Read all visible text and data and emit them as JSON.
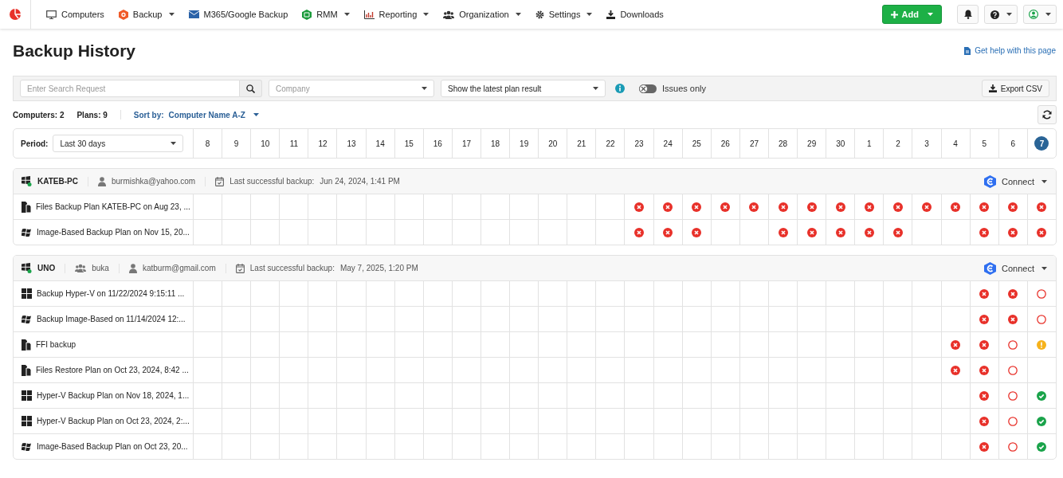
{
  "nav": {
    "items": [
      {
        "label": "Computers",
        "dropdown": false
      },
      {
        "label": "Backup",
        "dropdown": true
      },
      {
        "label": "M365/Google Backup",
        "dropdown": false
      },
      {
        "label": "RMM",
        "dropdown": true
      },
      {
        "label": "Reporting",
        "dropdown": true
      },
      {
        "label": "Organization",
        "dropdown": true
      },
      {
        "label": "Settings",
        "dropdown": true
      },
      {
        "label": "Downloads",
        "dropdown": false
      }
    ],
    "add_button": "Add"
  },
  "page": {
    "title": "Backup History",
    "help_link": "Get help with this page"
  },
  "filters": {
    "search": {
      "placeholder": "Enter Search Request"
    },
    "company": {
      "placeholder": "Company"
    },
    "result_mode": "Show the latest plan result",
    "issues_only": {
      "label": "Issues only",
      "on": false
    },
    "export": "Export CSV"
  },
  "summary": {
    "computers_label": "Computers:",
    "computers": "2",
    "plans_label": "Plans:",
    "plans": "9",
    "sort_label": "Sort by:",
    "sort_value": "Computer Name A-Z"
  },
  "period": {
    "label": "Period:",
    "value": "Last 30 days"
  },
  "days": [
    {
      "label": "8",
      "selected": false
    },
    {
      "label": "9",
      "selected": false
    },
    {
      "label": "10",
      "selected": false
    },
    {
      "label": "11",
      "selected": false
    },
    {
      "label": "12",
      "selected": false
    },
    {
      "label": "13",
      "selected": false
    },
    {
      "label": "14",
      "selected": false
    },
    {
      "label": "15",
      "selected": false
    },
    {
      "label": "16",
      "selected": false
    },
    {
      "label": "17",
      "selected": false
    },
    {
      "label": "18",
      "selected": false
    },
    {
      "label": "19",
      "selected": false
    },
    {
      "label": "20",
      "selected": false
    },
    {
      "label": "21",
      "selected": false
    },
    {
      "label": "22",
      "selected": false
    },
    {
      "label": "23",
      "selected": false
    },
    {
      "label": "24",
      "selected": false
    },
    {
      "label": "25",
      "selected": false
    },
    {
      "label": "26",
      "selected": false
    },
    {
      "label": "27",
      "selected": false
    },
    {
      "label": "28",
      "selected": false
    },
    {
      "label": "29",
      "selected": false
    },
    {
      "label": "30",
      "selected": false
    },
    {
      "label": "1",
      "selected": false
    },
    {
      "label": "2",
      "selected": false
    },
    {
      "label": "3",
      "selected": false
    },
    {
      "label": "4",
      "selected": false
    },
    {
      "label": "5",
      "selected": false
    },
    {
      "label": "6",
      "selected": false
    },
    {
      "label": "7",
      "selected": true
    }
  ],
  "groups": [
    {
      "computer": "KATEB-PC",
      "online": true,
      "email": "burmishka@yahoo.com",
      "last_backup_label": "Last successful backup:",
      "last_backup": "Jun 24, 2024, 1:41 PM",
      "connect": "Connect",
      "plans": [
        {
          "kind": "files",
          "name": "Files Backup Plan KATEB-PC on Aug 23, ...",
          "cells": [
            {
              "kind": "empty"
            },
            {
              "kind": "empty"
            },
            {
              "kind": "empty"
            },
            {
              "kind": "empty"
            },
            {
              "kind": "empty"
            },
            {
              "kind": "empty"
            },
            {
              "kind": "empty"
            },
            {
              "kind": "empty"
            },
            {
              "kind": "empty"
            },
            {
              "kind": "empty"
            },
            {
              "kind": "empty"
            },
            {
              "kind": "empty"
            },
            {
              "kind": "empty"
            },
            {
              "kind": "empty"
            },
            {
              "kind": "empty"
            },
            {
              "kind": "failed"
            },
            {
              "kind": "failed"
            },
            {
              "kind": "failed"
            },
            {
              "kind": "failed"
            },
            {
              "kind": "failed"
            },
            {
              "kind": "failed"
            },
            {
              "kind": "failed"
            },
            {
              "kind": "failed"
            },
            {
              "kind": "failed"
            },
            {
              "kind": "failed"
            },
            {
              "kind": "failed"
            },
            {
              "kind": "failed"
            },
            {
              "kind": "failed"
            },
            {
              "kind": "failed"
            },
            {
              "kind": "failed"
            }
          ]
        },
        {
          "kind": "image",
          "name": "Image-Based Backup Plan on Nov 15, 20...",
          "cells": [
            {
              "kind": "empty"
            },
            {
              "kind": "empty"
            },
            {
              "kind": "empty"
            },
            {
              "kind": "empty"
            },
            {
              "kind": "empty"
            },
            {
              "kind": "empty"
            },
            {
              "kind": "empty"
            },
            {
              "kind": "empty"
            },
            {
              "kind": "empty"
            },
            {
              "kind": "empty"
            },
            {
              "kind": "empty"
            },
            {
              "kind": "empty"
            },
            {
              "kind": "empty"
            },
            {
              "kind": "empty"
            },
            {
              "kind": "empty"
            },
            {
              "kind": "failed"
            },
            {
              "kind": "failed"
            },
            {
              "kind": "failed"
            },
            {
              "kind": "empty"
            },
            {
              "kind": "empty"
            },
            {
              "kind": "failed"
            },
            {
              "kind": "failed"
            },
            {
              "kind": "failed"
            },
            {
              "kind": "failed"
            },
            {
              "kind": "failed"
            },
            {
              "kind": "empty"
            },
            {
              "kind": "empty"
            },
            {
              "kind": "failed"
            },
            {
              "kind": "failed"
            },
            {
              "kind": "failed"
            }
          ]
        }
      ]
    },
    {
      "computer": "UNO",
      "online": true,
      "company": "buka",
      "email": "katburm@gmail.com",
      "last_backup_label": "Last successful backup:",
      "last_backup": "May 7, 2025, 1:20 PM",
      "connect": "Connect",
      "plans": [
        {
          "kind": "hyperv",
          "name": "Backup Hyper-V on 11/22/2024 9:15:11 ...",
          "cells": [
            {
              "kind": "empty"
            },
            {
              "kind": "empty"
            },
            {
              "kind": "empty"
            },
            {
              "kind": "empty"
            },
            {
              "kind": "empty"
            },
            {
              "kind": "empty"
            },
            {
              "kind": "empty"
            },
            {
              "kind": "empty"
            },
            {
              "kind": "empty"
            },
            {
              "kind": "empty"
            },
            {
              "kind": "empty"
            },
            {
              "kind": "empty"
            },
            {
              "kind": "empty"
            },
            {
              "kind": "empty"
            },
            {
              "kind": "empty"
            },
            {
              "kind": "empty"
            },
            {
              "kind": "empty"
            },
            {
              "kind": "empty"
            },
            {
              "kind": "empty"
            },
            {
              "kind": "empty"
            },
            {
              "kind": "empty"
            },
            {
              "kind": "empty"
            },
            {
              "kind": "empty"
            },
            {
              "kind": "empty"
            },
            {
              "kind": "empty"
            },
            {
              "kind": "empty"
            },
            {
              "kind": "empty"
            },
            {
              "kind": "failed"
            },
            {
              "kind": "failed"
            },
            {
              "kind": "missed"
            }
          ]
        },
        {
          "kind": "image",
          "name": "Backup Image-Based on 11/14/2024 12:...",
          "cells": [
            {
              "kind": "empty"
            },
            {
              "kind": "empty"
            },
            {
              "kind": "empty"
            },
            {
              "kind": "empty"
            },
            {
              "kind": "empty"
            },
            {
              "kind": "empty"
            },
            {
              "kind": "empty"
            },
            {
              "kind": "empty"
            },
            {
              "kind": "empty"
            },
            {
              "kind": "empty"
            },
            {
              "kind": "empty"
            },
            {
              "kind": "empty"
            },
            {
              "kind": "empty"
            },
            {
              "kind": "empty"
            },
            {
              "kind": "empty"
            },
            {
              "kind": "empty"
            },
            {
              "kind": "empty"
            },
            {
              "kind": "empty"
            },
            {
              "kind": "empty"
            },
            {
              "kind": "empty"
            },
            {
              "kind": "empty"
            },
            {
              "kind": "empty"
            },
            {
              "kind": "empty"
            },
            {
              "kind": "empty"
            },
            {
              "kind": "empty"
            },
            {
              "kind": "empty"
            },
            {
              "kind": "empty"
            },
            {
              "kind": "failed"
            },
            {
              "kind": "failed"
            },
            {
              "kind": "missed"
            }
          ]
        },
        {
          "kind": "files",
          "name": "FFI backup",
          "cells": [
            {
              "kind": "empty"
            },
            {
              "kind": "empty"
            },
            {
              "kind": "empty"
            },
            {
              "kind": "empty"
            },
            {
              "kind": "empty"
            },
            {
              "kind": "empty"
            },
            {
              "kind": "empty"
            },
            {
              "kind": "empty"
            },
            {
              "kind": "empty"
            },
            {
              "kind": "empty"
            },
            {
              "kind": "empty"
            },
            {
              "kind": "empty"
            },
            {
              "kind": "empty"
            },
            {
              "kind": "empty"
            },
            {
              "kind": "empty"
            },
            {
              "kind": "empty"
            },
            {
              "kind": "empty"
            },
            {
              "kind": "empty"
            },
            {
              "kind": "empty"
            },
            {
              "kind": "empty"
            },
            {
              "kind": "empty"
            },
            {
              "kind": "empty"
            },
            {
              "kind": "empty"
            },
            {
              "kind": "empty"
            },
            {
              "kind": "empty"
            },
            {
              "kind": "empty"
            },
            {
              "kind": "failed"
            },
            {
              "kind": "failed"
            },
            {
              "kind": "missed"
            },
            {
              "kind": "warning"
            }
          ]
        },
        {
          "kind": "files",
          "name": "Files Restore Plan on Oct 23, 2024, 8:42 ...",
          "cells": [
            {
              "kind": "empty"
            },
            {
              "kind": "empty"
            },
            {
              "kind": "empty"
            },
            {
              "kind": "empty"
            },
            {
              "kind": "empty"
            },
            {
              "kind": "empty"
            },
            {
              "kind": "empty"
            },
            {
              "kind": "empty"
            },
            {
              "kind": "empty"
            },
            {
              "kind": "empty"
            },
            {
              "kind": "empty"
            },
            {
              "kind": "empty"
            },
            {
              "kind": "empty"
            },
            {
              "kind": "empty"
            },
            {
              "kind": "empty"
            },
            {
              "kind": "empty"
            },
            {
              "kind": "empty"
            },
            {
              "kind": "empty"
            },
            {
              "kind": "empty"
            },
            {
              "kind": "empty"
            },
            {
              "kind": "empty"
            },
            {
              "kind": "empty"
            },
            {
              "kind": "empty"
            },
            {
              "kind": "empty"
            },
            {
              "kind": "empty"
            },
            {
              "kind": "empty"
            },
            {
              "kind": "failed"
            },
            {
              "kind": "failed"
            },
            {
              "kind": "missed"
            },
            {
              "kind": "empty"
            }
          ]
        },
        {
          "kind": "hyperv",
          "name": "Hyper-V Backup Plan on Nov 18, 2024, 1...",
          "cells": [
            {
              "kind": "empty"
            },
            {
              "kind": "empty"
            },
            {
              "kind": "empty"
            },
            {
              "kind": "empty"
            },
            {
              "kind": "empty"
            },
            {
              "kind": "empty"
            },
            {
              "kind": "empty"
            },
            {
              "kind": "empty"
            },
            {
              "kind": "empty"
            },
            {
              "kind": "empty"
            },
            {
              "kind": "empty"
            },
            {
              "kind": "empty"
            },
            {
              "kind": "empty"
            },
            {
              "kind": "empty"
            },
            {
              "kind": "empty"
            },
            {
              "kind": "empty"
            },
            {
              "kind": "empty"
            },
            {
              "kind": "empty"
            },
            {
              "kind": "empty"
            },
            {
              "kind": "empty"
            },
            {
              "kind": "empty"
            },
            {
              "kind": "empty"
            },
            {
              "kind": "empty"
            },
            {
              "kind": "empty"
            },
            {
              "kind": "empty"
            },
            {
              "kind": "empty"
            },
            {
              "kind": "empty"
            },
            {
              "kind": "failed"
            },
            {
              "kind": "missed"
            },
            {
              "kind": "success"
            }
          ]
        },
        {
          "kind": "hyperv",
          "name": "Hyper-V Backup Plan on Oct 23, 2024, 2:...",
          "cells": [
            {
              "kind": "empty"
            },
            {
              "kind": "empty"
            },
            {
              "kind": "empty"
            },
            {
              "kind": "empty"
            },
            {
              "kind": "empty"
            },
            {
              "kind": "empty"
            },
            {
              "kind": "empty"
            },
            {
              "kind": "empty"
            },
            {
              "kind": "empty"
            },
            {
              "kind": "empty"
            },
            {
              "kind": "empty"
            },
            {
              "kind": "empty"
            },
            {
              "kind": "empty"
            },
            {
              "kind": "empty"
            },
            {
              "kind": "empty"
            },
            {
              "kind": "empty"
            },
            {
              "kind": "empty"
            },
            {
              "kind": "empty"
            },
            {
              "kind": "empty"
            },
            {
              "kind": "empty"
            },
            {
              "kind": "empty"
            },
            {
              "kind": "empty"
            },
            {
              "kind": "empty"
            },
            {
              "kind": "empty"
            },
            {
              "kind": "empty"
            },
            {
              "kind": "empty"
            },
            {
              "kind": "empty"
            },
            {
              "kind": "failed"
            },
            {
              "kind": "missed"
            },
            {
              "kind": "success"
            }
          ]
        },
        {
          "kind": "image",
          "name": "Image-Based Backup Plan on Oct 23, 20...",
          "cells": [
            {
              "kind": "empty"
            },
            {
              "kind": "empty"
            },
            {
              "kind": "empty"
            },
            {
              "kind": "empty"
            },
            {
              "kind": "empty"
            },
            {
              "kind": "empty"
            },
            {
              "kind": "empty"
            },
            {
              "kind": "empty"
            },
            {
              "kind": "empty"
            },
            {
              "kind": "empty"
            },
            {
              "kind": "empty"
            },
            {
              "kind": "empty"
            },
            {
              "kind": "empty"
            },
            {
              "kind": "empty"
            },
            {
              "kind": "empty"
            },
            {
              "kind": "empty"
            },
            {
              "kind": "empty"
            },
            {
              "kind": "empty"
            },
            {
              "kind": "empty"
            },
            {
              "kind": "empty"
            },
            {
              "kind": "empty"
            },
            {
              "kind": "empty"
            },
            {
              "kind": "empty"
            },
            {
              "kind": "empty"
            },
            {
              "kind": "empty"
            },
            {
              "kind": "empty"
            },
            {
              "kind": "empty"
            },
            {
              "kind": "failed"
            },
            {
              "kind": "missed"
            },
            {
              "kind": "success"
            }
          ]
        }
      ]
    }
  ]
}
